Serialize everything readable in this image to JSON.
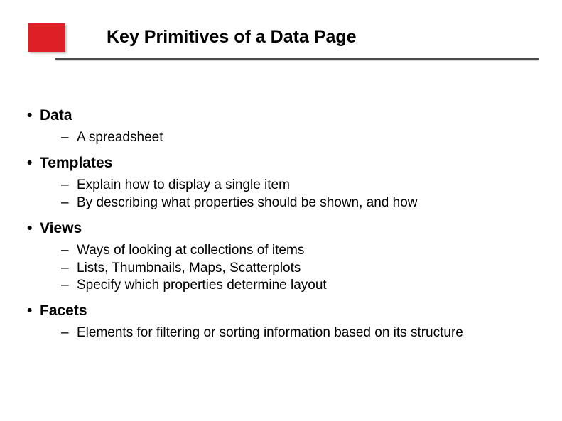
{
  "title": "Key Primitives of a Data Page",
  "bullets": [
    {
      "label": "Data",
      "subs": [
        "A spreadsheet"
      ]
    },
    {
      "label": "Templates",
      "subs": [
        "Explain how to display a single item",
        "By describing what properties should be shown, and how"
      ]
    },
    {
      "label": "Views",
      "subs": [
        "Ways of looking at collections of items",
        "Lists, Thumbnails, Maps, Scatterplots",
        "Specify which properties determine layout"
      ]
    },
    {
      "label": "Facets",
      "subs": [
        "Elements for filtering or sorting information based on its structure"
      ]
    }
  ]
}
